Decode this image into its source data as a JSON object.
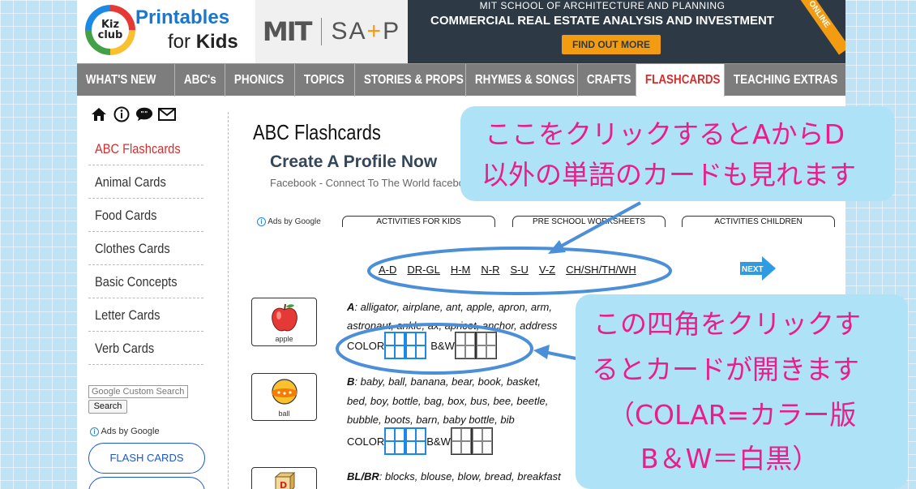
{
  "header": {
    "logo_top": "Kiz",
    "logo_bottom": "club",
    "title_line1": "Printables",
    "title_line2_pre": "for ",
    "title_line2_bold": "Kids",
    "mit_logo": "MIT",
    "sap_pre": "SA",
    "sap_plus": "+",
    "sap_post": "P",
    "ad_line1": "MIT SCHOOL OF ARCHITECTURE AND PLANNING",
    "ad_line2": "COMMERCIAL REAL ESTATE ANALYSIS AND INVESTMENT",
    "ad_cta": "FIND OUT MORE",
    "ad_corner": "ONLINE"
  },
  "nav": {
    "items": [
      {
        "label": "WHAT'S NEW"
      },
      {
        "label": "ABC's"
      },
      {
        "label": "PHONICS"
      },
      {
        "label": "TOPICS"
      },
      {
        "label": "STORIES & PROPS"
      },
      {
        "label": "RHYMES & SONGS"
      },
      {
        "label": "CRAFTS"
      },
      {
        "label": "FLASHCARDS"
      },
      {
        "label": "TEACHING EXTRAS"
      }
    ],
    "active": "FLASHCARDS"
  },
  "sidebar": {
    "icons": [
      "home-icon",
      "info-icon",
      "chat-icon",
      "mail-icon"
    ],
    "items": [
      {
        "label": "ABC Flashcards"
      },
      {
        "label": "Animal Cards"
      },
      {
        "label": "Food Cards"
      },
      {
        "label": "Clothes Cards"
      },
      {
        "label": "Basic Concepts"
      },
      {
        "label": "Letter Cards"
      },
      {
        "label": "Verb Cards"
      }
    ],
    "search_placeholder": "Google Custom Search",
    "search_button": "Search",
    "ads_by_google": "Ads by Google",
    "flash_button": "FLASH CARDS"
  },
  "content": {
    "title": "ABC Flashcards",
    "profile_title": "Create A Profile Now",
    "profile_sub": "Facebook - Connect To The World facebook.com",
    "ads_by_google": "Ads by Google",
    "ad_pills": [
      "ACTIVITIES FOR KIDS",
      "PRE SCHOOL WORKSHEETS",
      "ACTIVITIES CHILDREN"
    ],
    "letter_links": [
      "A-D",
      "DR-GL",
      "H-M",
      "N-R",
      "S-U",
      "V-Z",
      "CH/SH/TH/WH"
    ],
    "next_label": "NEXT",
    "sections": [
      {
        "card_label": "apple",
        "letter": "A",
        "line1": ": alligator, airplane, ant, apple, apron, arm,",
        "line2": "astronaut, ankle, ax, apricot, anchor, address",
        "color_label": "COLOR",
        "bw_label": "B&W"
      },
      {
        "card_label": "ball",
        "letter": "B",
        "line1": ": baby, ball, banana, bear, book, basket,",
        "line2": "bed, boy, bottle, bag, box, bus, bee, beetle,",
        "line3": "bubble, boots, barn, baby bottle, bib",
        "color_label": "COLOR",
        "bw_label": "B&W"
      },
      {
        "letter": "BL/BR",
        "line1": ": blocks, blouse, blow, bread, breakfast"
      }
    ]
  },
  "annotations": {
    "bubble1_line1": "ここをクリックするとAからD",
    "bubble1_line2": "以外の単語のカードも見れます",
    "bubble2_line1": "この四角をクリックす",
    "bubble2_line2": "るとカードが開きます",
    "bubble2_line3": "（COLAR=カラー版",
    "bubble2_line4": "B＆W＝白黒）",
    "text_color": "#e91e8c",
    "bubble_color": "#aee2f7",
    "arrow_color": "#4a8fd8"
  }
}
